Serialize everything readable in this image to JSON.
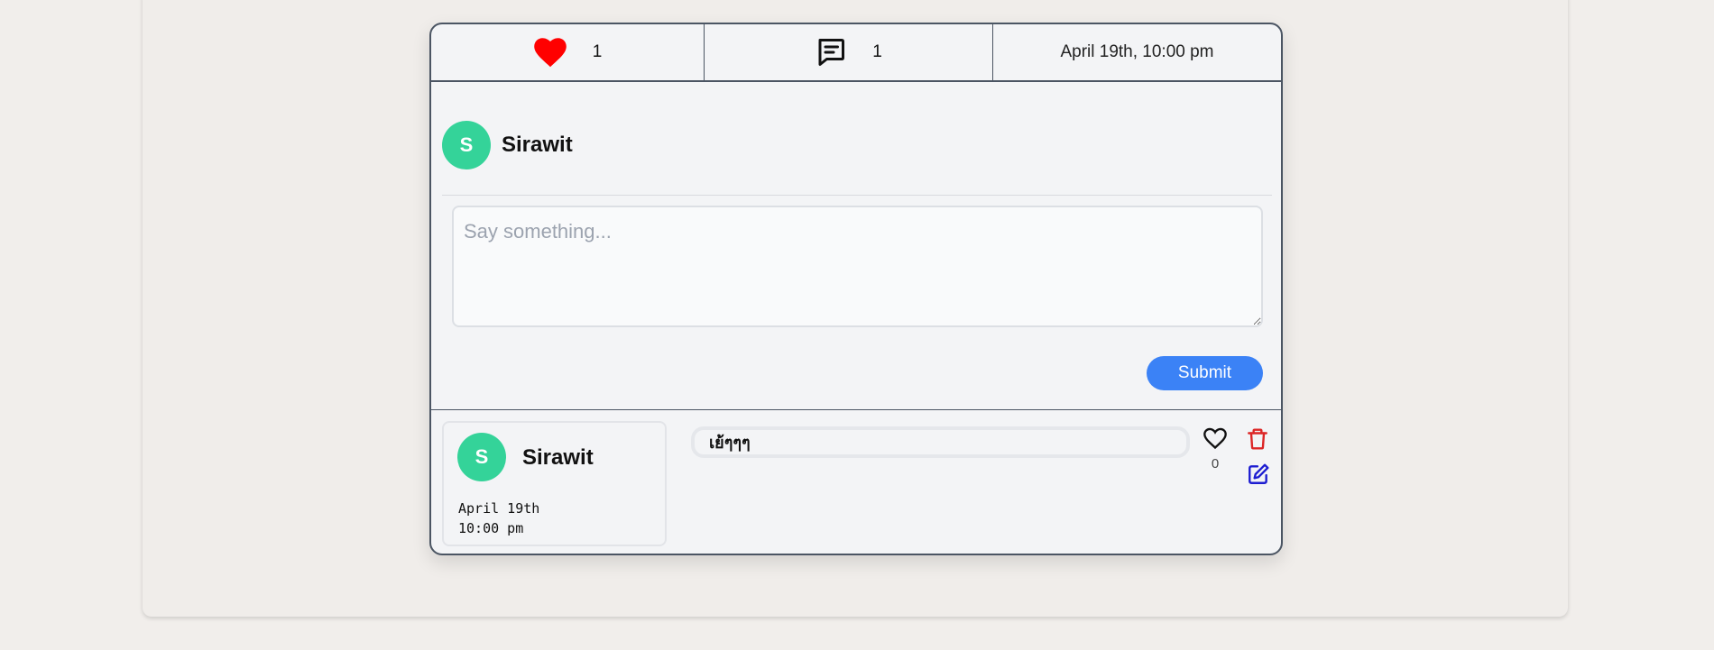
{
  "post": {
    "likes_count": "1",
    "comments_count": "1",
    "posted_at": "April 19th, 10:00 pm"
  },
  "composer": {
    "author_initial": "S",
    "author_name": "Sirawit",
    "placeholder": "Say something...",
    "submit_label": "Submit"
  },
  "comments": [
    {
      "author_initial": "S",
      "author_name": "Sirawit",
      "date": "April 19th\n10:00 pm",
      "text": "เย้ๆๆๆ",
      "likes": "0"
    }
  ],
  "colors": {
    "heart": "#ff0000",
    "avatar": "#34d399",
    "submit": "#3b82f6",
    "delete": "#dc2626",
    "edit": "#1d1dd1"
  },
  "icons": [
    "heart-icon",
    "comment-icon",
    "heart-outline-icon",
    "trash-icon",
    "edit-icon"
  ]
}
